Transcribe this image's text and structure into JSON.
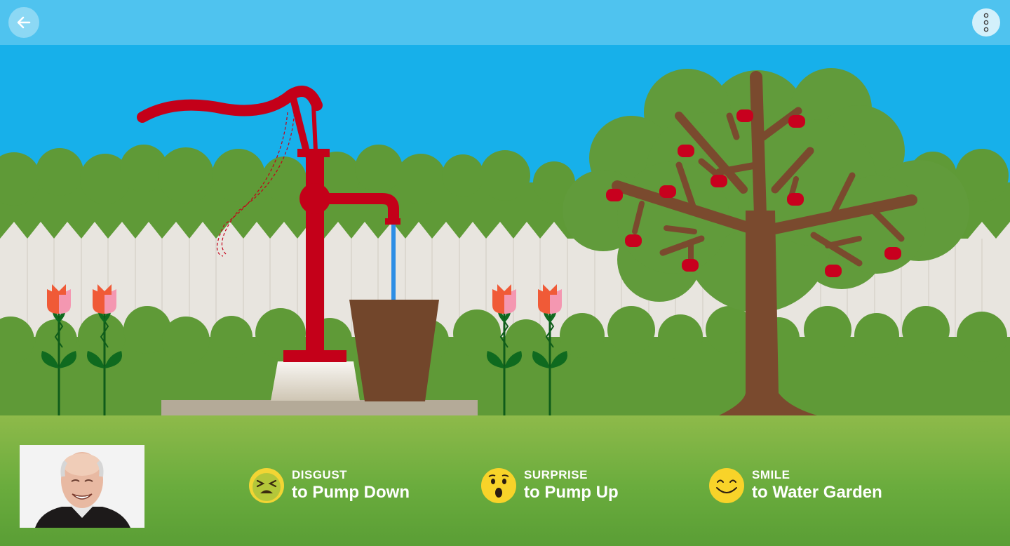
{
  "topbar": {
    "back_icon": "arrow-left-icon",
    "menu_icon": "more-vertical-icon"
  },
  "scene": {
    "sky_color": "#17b0ea",
    "hedge_color": "#5f9a37",
    "fence_color": "#e8e5df",
    "pump_color": "#c40019",
    "water_color": "#2d8ee5",
    "pot_color": "#72462b",
    "trunk_color": "#7a4a2e",
    "foliage_color": "#619b3b",
    "apple_color": "#c8001e",
    "tulip_colors": [
      "#f05a37",
      "#f497b1"
    ]
  },
  "controls": [
    {
      "emotion": "DISGUST",
      "action": "to Pump Down",
      "icon": "disgust-face-icon"
    },
    {
      "emotion": "SURPRISE",
      "action": "to Pump Up",
      "icon": "surprise-face-icon"
    },
    {
      "emotion": "SMILE",
      "action": "to Water Garden",
      "icon": "smile-face-icon"
    }
  ],
  "webcam": {
    "icon": "webcam-person-icon"
  }
}
